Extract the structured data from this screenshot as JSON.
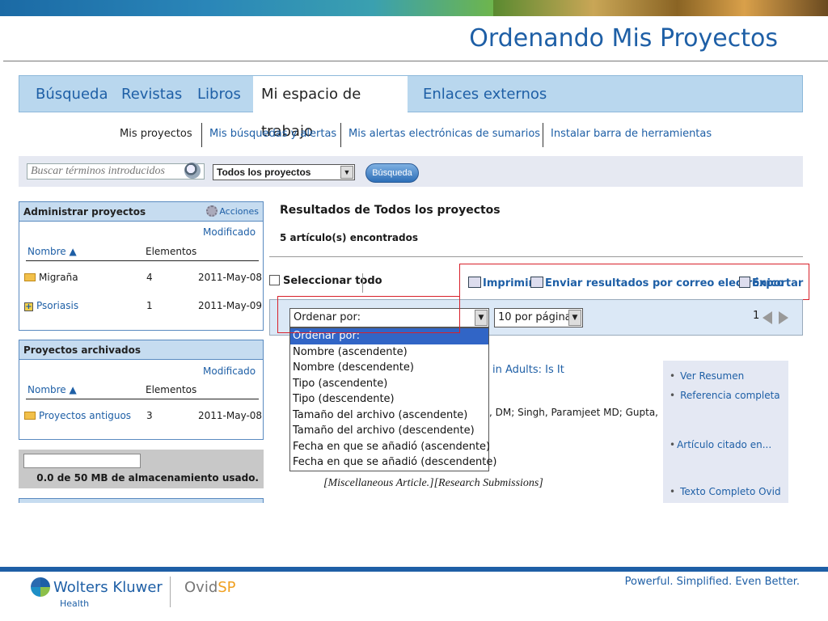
{
  "slide": {
    "title": "Ordenando Mis Proyectos"
  },
  "main_nav": {
    "tabs": [
      "Búsqueda",
      "Revistas",
      "Libros",
      "Mi espacio de trabajo",
      "Enlaces externos"
    ]
  },
  "sub_nav": {
    "items": [
      "Mis proyectos",
      "Mis búsquedas y alertas",
      "Mis alertas electrónicas de sumarios",
      "Instalar barra de herramientas"
    ]
  },
  "search": {
    "placeholder": "Buscar términos introducidos",
    "scope_value": "Todos los proyectos",
    "button_label": "Búsqueda"
  },
  "manage_panel": {
    "title": "Administrar proyectos",
    "actions_label": "Acciones",
    "col_modified": "Modificado",
    "col_name": "Nombre ▲",
    "col_elements": "Elementos",
    "rows": [
      {
        "name": "Migraña",
        "count": "4",
        "date": "2011-May-08"
      },
      {
        "name": "Psoriasis",
        "count": "1",
        "date": "2011-May-09"
      }
    ]
  },
  "archived_panel": {
    "title": "Proyectos archivados",
    "col_modified": "Modificado",
    "col_name": "Nombre ▲",
    "col_elements": "Elementos",
    "rows": [
      {
        "name": "Proyectos antiguos",
        "count": "3",
        "date": "2011-May-08"
      }
    ]
  },
  "storage": {
    "text": "0.0 de 50 MB de almacenamiento usado.",
    "used_fraction": 0.0
  },
  "results": {
    "title": "Resultados de Todos los proyectos",
    "count": "5 artículo(s) encontrados",
    "select_all": "Seleccionar todo",
    "print": "Imprimir",
    "email": "Enviar resultados por correo electrónico",
    "export": "Exportar",
    "sort_value": "Ordenar por:",
    "per_page_value": "10 por página",
    "page": "1",
    "sort_options": [
      "Ordenar por:",
      "Nombre (ascendente)",
      "Nombre (descendente)",
      "Tipo (ascendente)",
      "Tipo (descendente)",
      "Tamaño del archivo (ascendente)",
      "Tamaño del archivo (descendente)",
      "Fecha en que se añadió (ascendente)",
      "Fecha en que se añadió (descendente)"
    ],
    "article_title_fragment": "in Adults: Is It",
    "article_authors_fragment": ", DM; Singh, Paramjeet MD; Gupta,",
    "article_type": "[Miscellaneous Article.][Research Submissions]"
  },
  "side_links": {
    "view_summary": "Ver Resumen",
    "full_reference": "Referencia completa",
    "cited_in": "Artículo citado en...",
    "full_text": "Texto Completo Ovid"
  },
  "footer": {
    "brand": "Wolters Kluwer",
    "brand_sub": "Health",
    "product_a": "Ovid",
    "product_b": "SP",
    "tagline": "Powerful. Simplified. Even Better."
  }
}
